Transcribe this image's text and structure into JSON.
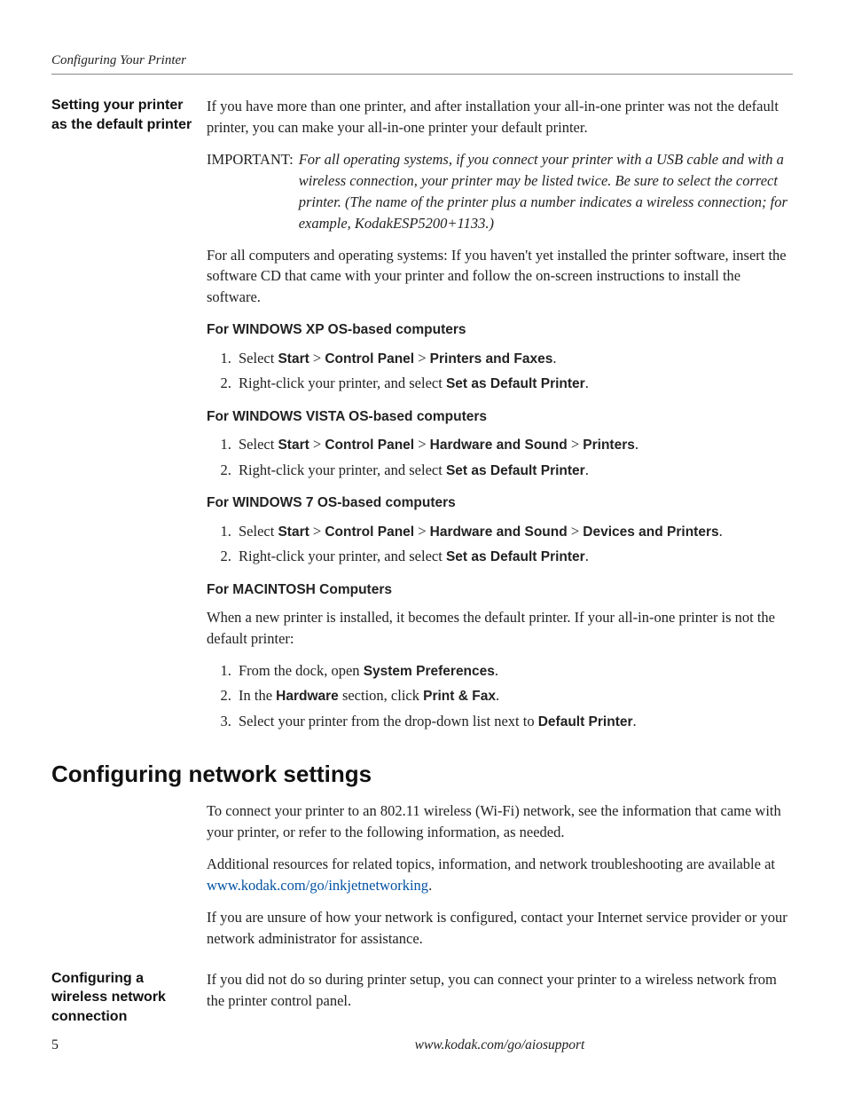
{
  "runningHead": "Configuring Your Printer",
  "side1": "Setting your printer as the default printer",
  "intro": "If you have more than one printer, and after installation your all-in-one printer was not the default printer, you can make your all-in-one printer your default printer.",
  "importantLabel": "IMPORTANT:",
  "importantText": "For all operating systems, if you connect your printer with a USB cable and with a wireless connection, your printer may be listed twice. Be sure to select the correct printer. (The name of the printer plus a number indicates a wireless connection; for example, KodakESP5200+1133.)",
  "allSystems": "For all computers and operating systems: If you haven't yet installed the printer software, insert the software CD that came with your printer and follow the on-screen instructions to install the software.",
  "xpHead": "For WINDOWS XP OS-based computers",
  "xp1a": "Select ",
  "xpStart": "Start",
  "sep1": "  > ",
  "xpCP": "Control Panel",
  "sep": " > ",
  "xpPF": "Printers and Faxes",
  "dot": ".",
  "xp2a": "Right-click your printer, and select ",
  "setDefault": "Set as Default Printer",
  "vistaHead": "For WINDOWS VISTA OS-based computers",
  "vistaHS": "Hardware and Sound",
  "vistaPrinters": "Printers",
  "win7Head": "For WINDOWS 7 OS-based computers",
  "win7DP": "Devices and Printers",
  "macHead": "For MACINTOSH Computers",
  "macIntro": "When a new printer is installed, it becomes the default printer. If your all-in-one printer is not the default printer:",
  "mac1a": "From the dock, open ",
  "macSysPref": "System Preferences",
  "mac2a": "In the ",
  "macHardware": "Hardware",
  "mac2b": " section, click ",
  "macPrintFax": "Print & Fax",
  "mac3a": "Select your printer from the drop-down list next to ",
  "macDefault": "Default Printer",
  "h1": "Configuring network settings",
  "net1": "To connect your printer to an 802.11 wireless (Wi-Fi) network, see the information that came with your printer, or refer to the following information, as needed.",
  "net2a": "Additional resources for related topics, information, and network troubleshooting are available at ",
  "netLink": "www.kodak.com/go/inkjetnetworking",
  "net3": "If you are unsure of how your network is configured, contact your Internet service provider or your network administrator for assistance.",
  "side2": "Configuring a wireless network connection",
  "wireless1": "If you did not do so during printer setup, you can connect your printer to a wireless network from the printer control panel.",
  "pageNum": "5",
  "footerUrl": "www.kodak.com/go/aiosupport"
}
